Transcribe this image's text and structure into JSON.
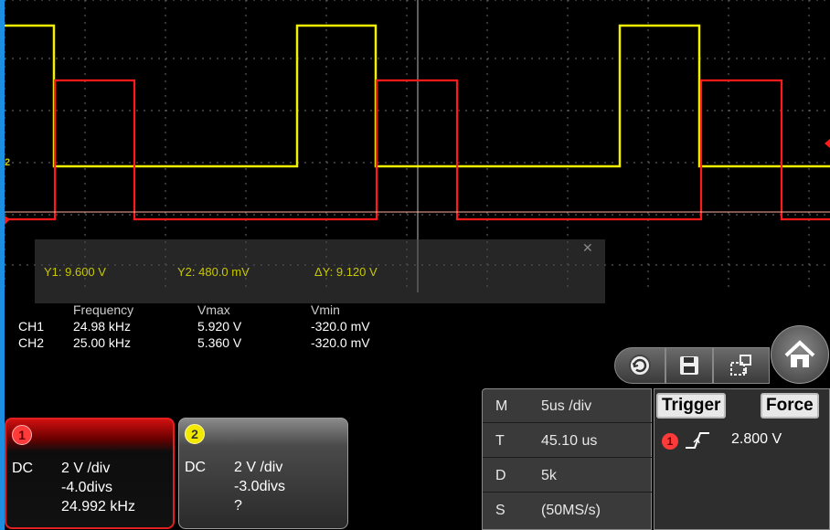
{
  "colors": {
    "ch1": "#ff1a1a",
    "ch2": "#f2f200",
    "grid": "#8a8a8a",
    "accent": "#1d8fe0"
  },
  "cursor": {
    "close_icon": "close-icon",
    "y1": "Y1: 9.600 V",
    "y2": "Y2: 480.0 mV",
    "dy": "ΔY: 9.120 V"
  },
  "measurements": {
    "headers": [
      "Frequency",
      "Vmax",
      "Vmin"
    ],
    "rows": [
      {
        "channel": "CH1",
        "frequency": "24.98 kHz",
        "vmax": "5.920 V",
        "vmin": "-320.0 mV"
      },
      {
        "channel": "CH2",
        "frequency": "25.00 kHz",
        "vmax": "5.360 V",
        "vmin": "-320.0 mV"
      }
    ]
  },
  "toolbar": {
    "icons": [
      "auto-scale-icon",
      "save-icon",
      "layout-icon",
      "home-icon"
    ]
  },
  "ch1": {
    "badge": "1",
    "coupling": "DC",
    "scale": "2 V /div",
    "offset": "-4.0divs",
    "freq": "24.992 kHz"
  },
  "ch2": {
    "badge": "2",
    "coupling": "DC",
    "scale": "2 V /div",
    "offset": "-3.0divs",
    "freq": "?"
  },
  "timebase": {
    "rows": [
      {
        "key": "M",
        "value": "5us /div"
      },
      {
        "key": "T",
        "value": "45.10 us"
      },
      {
        "key": "D",
        "value": "5k"
      },
      {
        "key": "S",
        "value": "(50MS/s)"
      }
    ]
  },
  "trigger": {
    "trigger_label": "Trigger",
    "force_label": "Force",
    "source_badge": "1",
    "edge": "rising",
    "level": "2.800 V"
  },
  "ch2_marker": "2"
}
